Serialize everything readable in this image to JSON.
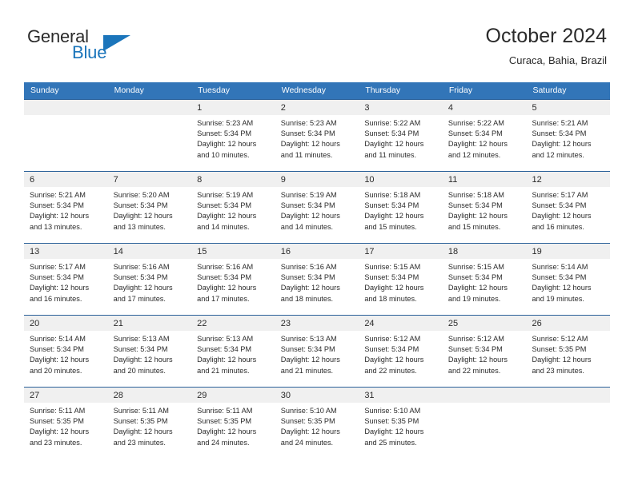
{
  "brand": {
    "word1": "General",
    "word2": "Blue",
    "triangle_color": "#1b75bb"
  },
  "header": {
    "title": "October 2024",
    "subtitle": "Curaca, Bahia, Brazil"
  },
  "theme": {
    "header_blue": "#3275b8",
    "row_border_blue": "#2a6099",
    "day_band_gray": "#f0f0f0",
    "text": "#2b2b2b"
  },
  "weekdays": [
    "Sunday",
    "Monday",
    "Tuesday",
    "Wednesday",
    "Thursday",
    "Friday",
    "Saturday"
  ],
  "weeks": [
    [
      {
        "day": "",
        "lines": []
      },
      {
        "day": "",
        "lines": []
      },
      {
        "day": "1",
        "lines": [
          "Sunrise: 5:23 AM",
          "Sunset: 5:34 PM",
          "Daylight: 12 hours",
          "and 10 minutes."
        ]
      },
      {
        "day": "2",
        "lines": [
          "Sunrise: 5:23 AM",
          "Sunset: 5:34 PM",
          "Daylight: 12 hours",
          "and 11 minutes."
        ]
      },
      {
        "day": "3",
        "lines": [
          "Sunrise: 5:22 AM",
          "Sunset: 5:34 PM",
          "Daylight: 12 hours",
          "and 11 minutes."
        ]
      },
      {
        "day": "4",
        "lines": [
          "Sunrise: 5:22 AM",
          "Sunset: 5:34 PM",
          "Daylight: 12 hours",
          "and 12 minutes."
        ]
      },
      {
        "day": "5",
        "lines": [
          "Sunrise: 5:21 AM",
          "Sunset: 5:34 PM",
          "Daylight: 12 hours",
          "and 12 minutes."
        ]
      }
    ],
    [
      {
        "day": "6",
        "lines": [
          "Sunrise: 5:21 AM",
          "Sunset: 5:34 PM",
          "Daylight: 12 hours",
          "and 13 minutes."
        ]
      },
      {
        "day": "7",
        "lines": [
          "Sunrise: 5:20 AM",
          "Sunset: 5:34 PM",
          "Daylight: 12 hours",
          "and 13 minutes."
        ]
      },
      {
        "day": "8",
        "lines": [
          "Sunrise: 5:19 AM",
          "Sunset: 5:34 PM",
          "Daylight: 12 hours",
          "and 14 minutes."
        ]
      },
      {
        "day": "9",
        "lines": [
          "Sunrise: 5:19 AM",
          "Sunset: 5:34 PM",
          "Daylight: 12 hours",
          "and 14 minutes."
        ]
      },
      {
        "day": "10",
        "lines": [
          "Sunrise: 5:18 AM",
          "Sunset: 5:34 PM",
          "Daylight: 12 hours",
          "and 15 minutes."
        ]
      },
      {
        "day": "11",
        "lines": [
          "Sunrise: 5:18 AM",
          "Sunset: 5:34 PM",
          "Daylight: 12 hours",
          "and 15 minutes."
        ]
      },
      {
        "day": "12",
        "lines": [
          "Sunrise: 5:17 AM",
          "Sunset: 5:34 PM",
          "Daylight: 12 hours",
          "and 16 minutes."
        ]
      }
    ],
    [
      {
        "day": "13",
        "lines": [
          "Sunrise: 5:17 AM",
          "Sunset: 5:34 PM",
          "Daylight: 12 hours",
          "and 16 minutes."
        ]
      },
      {
        "day": "14",
        "lines": [
          "Sunrise: 5:16 AM",
          "Sunset: 5:34 PM",
          "Daylight: 12 hours",
          "and 17 minutes."
        ]
      },
      {
        "day": "15",
        "lines": [
          "Sunrise: 5:16 AM",
          "Sunset: 5:34 PM",
          "Daylight: 12 hours",
          "and 17 minutes."
        ]
      },
      {
        "day": "16",
        "lines": [
          "Sunrise: 5:16 AM",
          "Sunset: 5:34 PM",
          "Daylight: 12 hours",
          "and 18 minutes."
        ]
      },
      {
        "day": "17",
        "lines": [
          "Sunrise: 5:15 AM",
          "Sunset: 5:34 PM",
          "Daylight: 12 hours",
          "and 18 minutes."
        ]
      },
      {
        "day": "18",
        "lines": [
          "Sunrise: 5:15 AM",
          "Sunset: 5:34 PM",
          "Daylight: 12 hours",
          "and 19 minutes."
        ]
      },
      {
        "day": "19",
        "lines": [
          "Sunrise: 5:14 AM",
          "Sunset: 5:34 PM",
          "Daylight: 12 hours",
          "and 19 minutes."
        ]
      }
    ],
    [
      {
        "day": "20",
        "lines": [
          "Sunrise: 5:14 AM",
          "Sunset: 5:34 PM",
          "Daylight: 12 hours",
          "and 20 minutes."
        ]
      },
      {
        "day": "21",
        "lines": [
          "Sunrise: 5:13 AM",
          "Sunset: 5:34 PM",
          "Daylight: 12 hours",
          "and 20 minutes."
        ]
      },
      {
        "day": "22",
        "lines": [
          "Sunrise: 5:13 AM",
          "Sunset: 5:34 PM",
          "Daylight: 12 hours",
          "and 21 minutes."
        ]
      },
      {
        "day": "23",
        "lines": [
          "Sunrise: 5:13 AM",
          "Sunset: 5:34 PM",
          "Daylight: 12 hours",
          "and 21 minutes."
        ]
      },
      {
        "day": "24",
        "lines": [
          "Sunrise: 5:12 AM",
          "Sunset: 5:34 PM",
          "Daylight: 12 hours",
          "and 22 minutes."
        ]
      },
      {
        "day": "25",
        "lines": [
          "Sunrise: 5:12 AM",
          "Sunset: 5:34 PM",
          "Daylight: 12 hours",
          "and 22 minutes."
        ]
      },
      {
        "day": "26",
        "lines": [
          "Sunrise: 5:12 AM",
          "Sunset: 5:35 PM",
          "Daylight: 12 hours",
          "and 23 minutes."
        ]
      }
    ],
    [
      {
        "day": "27",
        "lines": [
          "Sunrise: 5:11 AM",
          "Sunset: 5:35 PM",
          "Daylight: 12 hours",
          "and 23 minutes."
        ]
      },
      {
        "day": "28",
        "lines": [
          "Sunrise: 5:11 AM",
          "Sunset: 5:35 PM",
          "Daylight: 12 hours",
          "and 23 minutes."
        ]
      },
      {
        "day": "29",
        "lines": [
          "Sunrise: 5:11 AM",
          "Sunset: 5:35 PM",
          "Daylight: 12 hours",
          "and 24 minutes."
        ]
      },
      {
        "day": "30",
        "lines": [
          "Sunrise: 5:10 AM",
          "Sunset: 5:35 PM",
          "Daylight: 12 hours",
          "and 24 minutes."
        ]
      },
      {
        "day": "31",
        "lines": [
          "Sunrise: 5:10 AM",
          "Sunset: 5:35 PM",
          "Daylight: 12 hours",
          "and 25 minutes."
        ]
      },
      {
        "day": "",
        "lines": []
      },
      {
        "day": "",
        "lines": []
      }
    ]
  ]
}
